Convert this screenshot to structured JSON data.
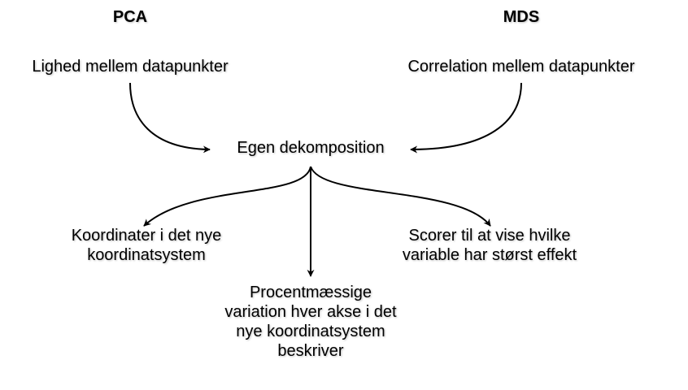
{
  "diagram": {
    "headings": {
      "pca": "PCA",
      "mds": "MDS"
    },
    "inputs": {
      "pca_input": "Lighed mellem datapunkter",
      "mds_input": "Correlation mellem datapunkter"
    },
    "center": "Egen dekomposition",
    "outputs": {
      "coordinates": "Koordinater i det nye\nkoordinatsystem",
      "variation": "Procentmæssige\nvariation hver akse i det\nnye koordinatsystem\nbeskriver",
      "scores": "Scorer til at vise hvilke\nvariable har størst effekt"
    }
  }
}
